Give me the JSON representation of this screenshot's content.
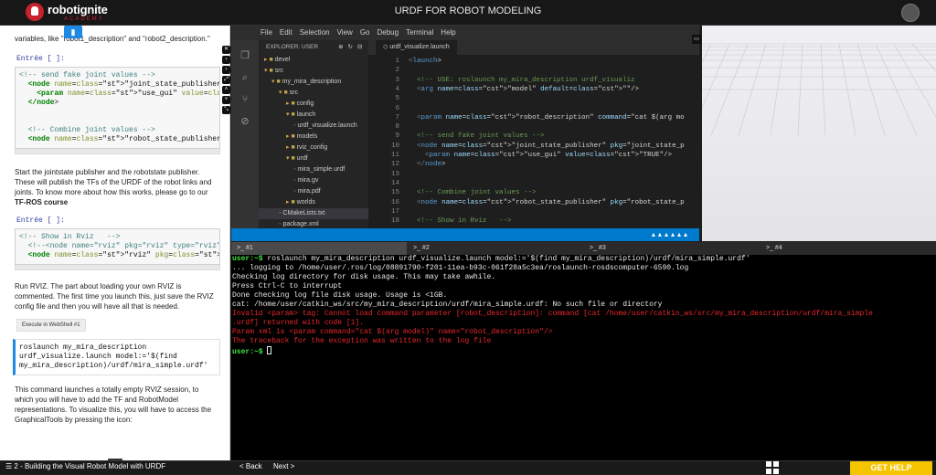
{
  "header": {
    "brand": "robotignite",
    "brand_sub": "ACADEMY",
    "title": "URDF FOR ROBOT MODELING"
  },
  "notebook": {
    "intro": "variables, like \"robot1_description\" and \"robot2_description.\"",
    "prompt1": "Entrée [ ]:",
    "cell1": [
      "<!-- send fake joint values -->",
      "  <node name=\"joint_state_publisher\" pkg=\"joint",
      "    <param name=\"use_gui\" value=\"TRUE\"/>",
      "  </node>",
      "",
      "",
      "  <!-- Combine joint values -->",
      "  <node name=\"robot_state_publisher\" pkg=\"robot_"
    ],
    "para1": "Start the jointstate publisher and the robotstate publisher. These will publish the TFs of the URDF of the robot links and joints. To know more about how this works, please go to our",
    "para1_bold": "TF-ROS course",
    "prompt2": "Entrée [ ]:",
    "cell2": [
      "<!-- Show in Rviz   -->",
      "  <!--<node name=\"rviz\" pkg=\"rviz\" type=\"rviz\" a",
      "  <node name=\"rviz\" pkg=\"rviz\" type=\"rviz\" args="
    ],
    "para2": "Run RVIZ. The part about loading your own RVIZ is commented. The first time you launch this, just save the RVIZ config file and then you will have all that is needed.",
    "run_button": "Execute in WebShell #1",
    "shell_cell": [
      "roslaunch my_mira_description",
      "urdf_visualize.launch model:='$(find",
      "my_mira_description)/urdf/mira_simple.urdf'"
    ],
    "para3": "This command launches a totally empty RVIZ session, to which you will have to add the TF and RobotModel representations. To visualize this, you will have to access the GraphicalTools by pressing the icon:"
  },
  "editor": {
    "menu": [
      "File",
      "Edit",
      "Selection",
      "View",
      "Go",
      "Debug",
      "Terminal",
      "Help"
    ],
    "explorer_title": "EXPLORER: USER",
    "tree": [
      {
        "label": "devel",
        "depth": 0,
        "type": "folder",
        "open": false
      },
      {
        "label": "src",
        "depth": 0,
        "type": "folder",
        "open": true
      },
      {
        "label": "my_mira_description",
        "depth": 1,
        "type": "folder",
        "open": true
      },
      {
        "label": "src",
        "depth": 2,
        "type": "folder",
        "open": true
      },
      {
        "label": "config",
        "depth": 3,
        "type": "folder",
        "open": false
      },
      {
        "label": "launch",
        "depth": 3,
        "type": "folder",
        "open": true
      },
      {
        "label": "urdf_visualize.launch",
        "depth": 4,
        "type": "file"
      },
      {
        "label": "models",
        "depth": 3,
        "type": "folder",
        "open": false
      },
      {
        "label": "rviz_config",
        "depth": 3,
        "type": "folder",
        "open": false
      },
      {
        "label": "urdf",
        "depth": 3,
        "type": "folder",
        "open": true
      },
      {
        "label": "mira_simple.urdf",
        "depth": 4,
        "type": "file"
      },
      {
        "label": "mira.gv",
        "depth": 4,
        "type": "file"
      },
      {
        "label": "mira.pdf",
        "depth": 4,
        "type": "file"
      },
      {
        "label": "worlds",
        "depth": 3,
        "type": "folder",
        "open": false
      },
      {
        "label": "CMakeLists.txt",
        "depth": 2,
        "type": "file",
        "selected": true
      },
      {
        "label": "package.xml",
        "depth": 2,
        "type": "file"
      }
    ],
    "tab": "urdf_visualize.launch",
    "lines": [
      {
        "n": "1",
        "t": "<launch>"
      },
      {
        "n": "2",
        "t": ""
      },
      {
        "n": "3",
        "t": "  <!-- USE: roslaunch my_mira_description urdf_visualiz"
      },
      {
        "n": "4",
        "t": "  <arg name=\"model\" default=\"\"/>"
      },
      {
        "n": "5",
        "t": ""
      },
      {
        "n": "6",
        "t": ""
      },
      {
        "n": "7",
        "t": "  <param name=\"robot_description\" command=\"cat $(arg mo"
      },
      {
        "n": "8",
        "t": ""
      },
      {
        "n": "9",
        "t": "  <!-- send fake joint values -->"
      },
      {
        "n": "10",
        "t": "  <node name=\"joint_state_publisher\" pkg=\"joint_state_p"
      },
      {
        "n": "11",
        "t": "    <param name=\"use_gui\" value=\"TRUE\"/>"
      },
      {
        "n": "12",
        "t": "  </node>"
      },
      {
        "n": "13",
        "t": ""
      },
      {
        "n": "14",
        "t": ""
      },
      {
        "n": "15",
        "t": "  <!-- Combine joint values -->"
      },
      {
        "n": "16",
        "t": "  <node name=\"robot_state_publisher\" pkg=\"robot_state_p"
      },
      {
        "n": "17",
        "t": ""
      },
      {
        "n": "18",
        "t": "  <!-- Show in Rviz   -->"
      }
    ]
  },
  "terminal": {
    "tabs": [
      ">_ #1",
      ">_ #2",
      ">_ #3",
      ">_ #4"
    ],
    "lines": [
      {
        "c": "tw",
        "p": "user:~$ ",
        "t": "roslaunch my_mira_description urdf_visualize.launch model:='$(find my_mira_description)/urdf/mira_simple.urdf'"
      },
      {
        "c": "tw",
        "t": "... logging to /home/user/.ros/log/08891790-f201-11ea-b93c-061f28a5c3ea/roslaunch-rosdscomputer-6590.log"
      },
      {
        "c": "tw",
        "t": "Checking log directory for disk usage. This may take awhile."
      },
      {
        "c": "tw",
        "t": "Press Ctrl-C to interrupt"
      },
      {
        "c": "tw",
        "t": "Done checking log file disk usage. Usage is <1GB."
      },
      {
        "c": "tw",
        "t": ""
      },
      {
        "c": "tw",
        "t": "cat: /home/user/catkin_ws/src/my_mira_description/urdf/mira_simple.urdf: No such file or directory"
      },
      {
        "c": "tr2",
        "t": "Invalid <param> tag: Cannot load command parameter [robot_description]: command [cat /home/user/catkin_ws/src/my_mira_description/urdf/mira_simple"
      },
      {
        "c": "tr2",
        "t": ".urdf] returned with code [1]."
      },
      {
        "c": "tw",
        "t": ""
      },
      {
        "c": "tr2",
        "t": "Param xml is <param command=\"cat $(arg model)\" name=\"robot_description\"/>"
      },
      {
        "c": "tr2",
        "t": "The traceback for the exception was written to the log file"
      },
      {
        "c": "tw",
        "p": "user:~$ ",
        "t": ""
      }
    ]
  },
  "bottom": {
    "lesson": "2 - Building the Visual Robot Model with URDF",
    "back": "< Back",
    "next": "Next >",
    "help": "GET HELP"
  }
}
